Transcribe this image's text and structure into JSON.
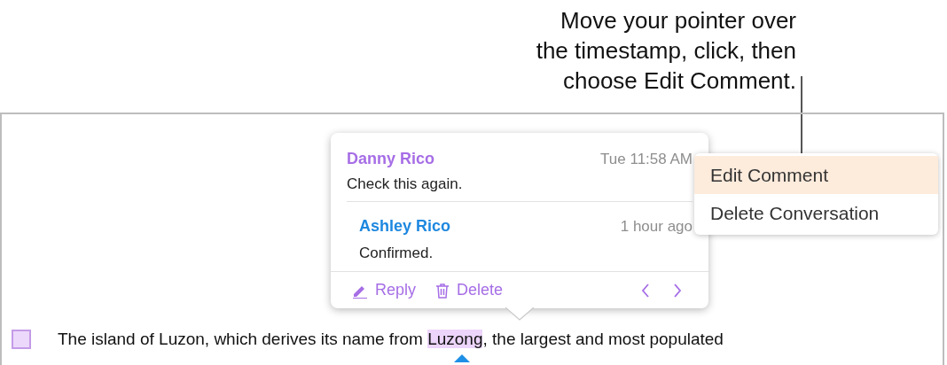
{
  "callout": {
    "lines": [
      "Move your pointer over",
      "the timestamp, click, then",
      "choose Edit Comment."
    ]
  },
  "comment": {
    "author": "Danny Rico",
    "time": "Tue 11:58 AM",
    "text": "Check this again.",
    "replies": [
      {
        "author": "Ashley Rico",
        "time": "1 hour ago",
        "text": "Confirmed."
      }
    ],
    "actions": [
      {
        "kind": "reply",
        "label": "Reply"
      },
      {
        "kind": "delete",
        "label": "Delete"
      }
    ]
  },
  "menu": [
    {
      "label": "Edit Comment",
      "selected": true
    },
    {
      "label": "Delete Conversation",
      "selected": false
    }
  ],
  "paragraph": {
    "before": "The island of Luzon, which derives its name from ",
    "highlight": "Luzong",
    "after": ", the largest and most populated"
  }
}
